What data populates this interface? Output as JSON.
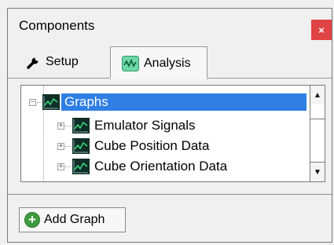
{
  "window": {
    "title": "Components",
    "close_glyph": "×"
  },
  "tabs": [
    {
      "label": "Setup",
      "icon": "wrench-icon",
      "active": false
    },
    {
      "label": "Analysis",
      "icon": "waveform-icon",
      "active": true
    }
  ],
  "tree": {
    "root": {
      "label": "Graphs",
      "icon": "graph-icon",
      "expander": "−",
      "selected": true
    },
    "children": [
      {
        "label": "Emulator Signals",
        "icon": "graph-icon",
        "expander": "+"
      },
      {
        "label": "Cube Position Data",
        "icon": "graph-icon",
        "expander": "+"
      },
      {
        "label": "Cube Orientation Data",
        "icon": "graph-icon",
        "expander": "+"
      }
    ],
    "scroll_up_glyph": "▲",
    "scroll_down_glyph": "▼"
  },
  "actions": {
    "add_graph_label": "Add Graph",
    "add_icon": "plus-circle-icon"
  },
  "colors": {
    "selection": "#2f7fe5",
    "close": "#e04343",
    "add_green": "#3f9a3f"
  }
}
